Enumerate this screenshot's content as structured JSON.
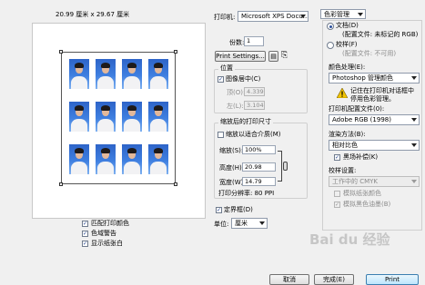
{
  "preview": {
    "dimensions_label": "20.99 厘米 x 29.67 厘米",
    "checkboxes": [
      {
        "label": "匹配打印颜色",
        "checked": true
      },
      {
        "label": "色域警告",
        "checked": true
      },
      {
        "label": "显示纸张白",
        "checked": true
      }
    ]
  },
  "printer": {
    "label": "打印机:",
    "value": "Microsoft XPS Docu...",
    "copies_label": "份数:",
    "copies_value": "1",
    "settings_button": "Print Settings..."
  },
  "position": {
    "title": "位置",
    "center_label": "图像居中(C)",
    "center_checked": true,
    "top_label": "顶(O):",
    "top_value": "4.339",
    "left_label": "左(L):",
    "left_value": "3.104"
  },
  "scaled": {
    "title": "缩放后的打印尺寸",
    "fit_label": "缩放以适合介质(M)",
    "fit_checked": false,
    "scale_label": "缩放(S):",
    "scale_value": "100%",
    "height_label": "高度(H):",
    "height_value": "20.98",
    "width_label": "宽度(W):",
    "width_value": "14.79",
    "resolution_label": "打印分辨率: 80 PPI"
  },
  "bounding": {
    "label": "定界框(D)",
    "checked": true,
    "unit_label": "单位:",
    "unit_value": "厘米"
  },
  "color_mgmt": {
    "header": "色彩管理",
    "doc_label": "文档(D)",
    "doc_profile": "(配置文件: 未标记的 RGB)",
    "doc_selected": true,
    "proof_label": "校样(F)",
    "proof_profile": "(配置文件: 不可用)",
    "proof_selected": false,
    "handling_label": "颜色处理(E):",
    "handling_value": "Photoshop 管理颜色",
    "warning_line1": "记住在打印机对话框中",
    "warning_line2": "停用色彩管理。",
    "printer_profile_label": "打印机配置文件(0):",
    "printer_profile_value": "Adobe RGB (1998)",
    "intent_label": "渲染方法(B):",
    "intent_value": "相对比色",
    "bpc_label": "黑场补偿(K)",
    "bpc_checked": true,
    "proof_setup_label": "校样设置:",
    "proof_setup_value": "工作中的 CMYK",
    "sim_paper_label": "模拟纸张颜色",
    "sim_black_label": "模拟黑色油墨(B)"
  },
  "footer": {
    "cancel": "取消",
    "done": "完成(E)",
    "print": "Print"
  },
  "watermark": "Bai du 经验"
}
